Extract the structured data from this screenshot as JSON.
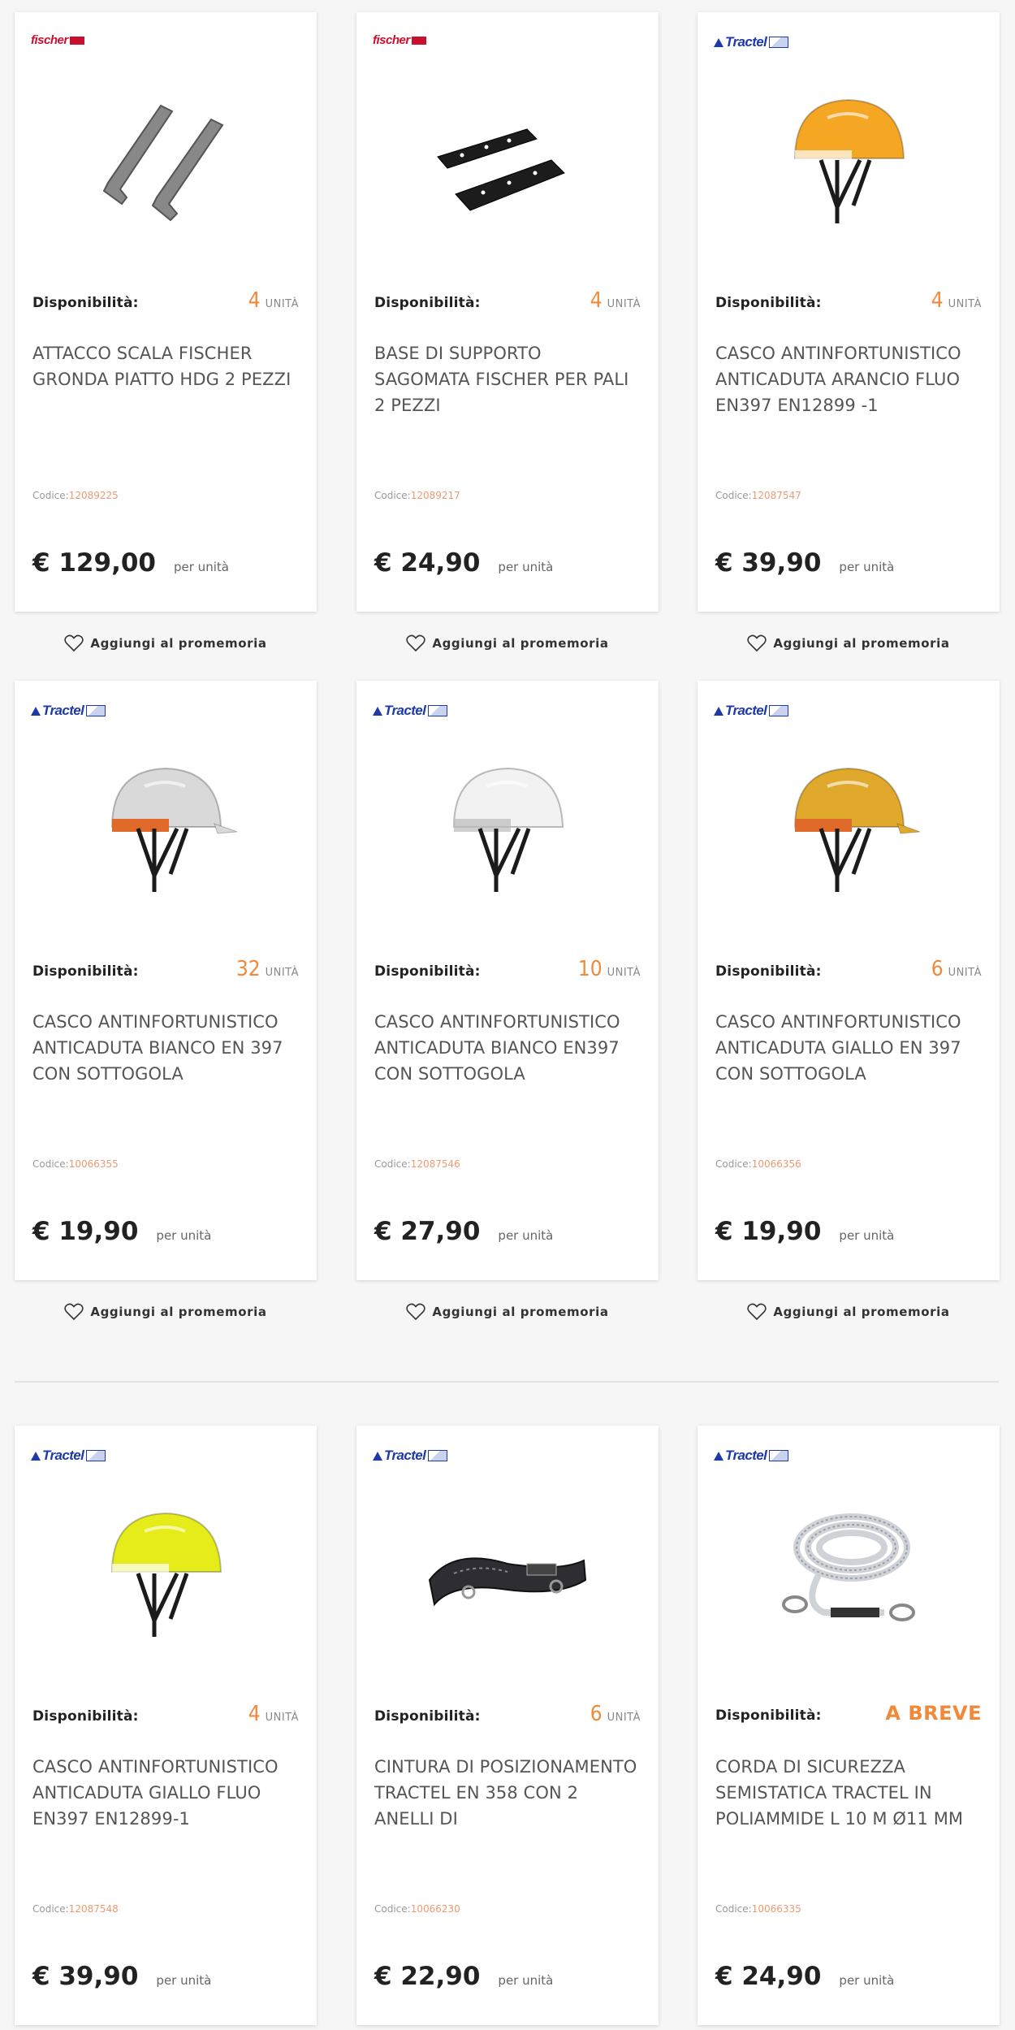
{
  "labels": {
    "availability": "Disponibilità:",
    "unit": "UNITÀ",
    "code": "Codice:",
    "per_unit": "per unità",
    "wishlist": "Aggiungi al promemoria"
  },
  "colors": {
    "accent": "#f08a3a",
    "code": "#ec9a73",
    "fischer": "#c8102e",
    "tractel": "#1e3aa8"
  },
  "products": [
    {
      "brand": "fischer",
      "brand_text": "fischer",
      "brand_sub": "",
      "image_icon": "ladder-bracket-icon",
      "availability": "4",
      "title": "ATTACCO SCALA FISCHER GRONDA PIATTO HDG 2 PEZZI",
      "code": "12089225",
      "price": "€ 129,00"
    },
    {
      "brand": "fischer",
      "brand_text": "fischer",
      "brand_sub": "",
      "image_icon": "support-plate-icon",
      "availability": "4",
      "title": "BASE DI SUPPORTO SAGOMATA FISCHER PER PALI 2 PEZZI",
      "code": "12089217",
      "price": "€ 24,90"
    },
    {
      "brand": "tractel",
      "brand_text": "Tractel",
      "image_icon": "orange-helmet-icon",
      "availability": "4",
      "title": "CASCO ANTINFORTUNISTICO ANTICADUTA ARANCIO FLUO EN397 EN12899 -1",
      "code": "12087547",
      "price": "€ 39,90"
    },
    {
      "brand": "tractel",
      "brand_text": "Tractel",
      "image_icon": "white-helmet-visor-icon",
      "availability": "32",
      "title": "CASCO ANTINFORTUNISTICO ANTICADUTA BIANCO EN 397 CON SOTTOGOLA",
      "code": "10066355",
      "price": "€ 19,90"
    },
    {
      "brand": "tractel",
      "brand_text": "Tractel",
      "image_icon": "white-helmet-icon",
      "availability": "10",
      "title": "CASCO ANTINFORTUNISTICO ANTICADUTA BIANCO EN397 CON SOTTOGOLA",
      "code": "12087546",
      "price": "€ 27,90"
    },
    {
      "brand": "tractel",
      "brand_text": "Tractel",
      "image_icon": "yellow-helmet-visor-icon",
      "availability": "6",
      "title": "CASCO ANTINFORTUNISTICO ANTICADUTA GIALLO EN 397 CON SOTTOGOLA",
      "code": "10066356",
      "price": "€ 19,90"
    },
    {
      "brand": "tractel",
      "brand_text": "Tractel",
      "image_icon": "yellow-fluo-helmet-icon",
      "availability": "4",
      "title": "CASCO ANTINFORTUNISTICO ANTICADUTA GIALLO FLUO EN397 EN12899-1",
      "code": "12087548",
      "price": "€ 39,90"
    },
    {
      "brand": "tractel",
      "brand_text": "Tractel",
      "image_icon": "harness-belt-icon",
      "availability": "6",
      "title": "CINTURA DI POSIZIONAMENTO TRACTEL EN 358 CON 2 ANELLI DI",
      "code": "10066230",
      "price": "€ 22,90"
    },
    {
      "brand": "tractel",
      "brand_text": "Tractel",
      "image_icon": "safety-rope-icon",
      "availability_text": "A BREVE",
      "title": "CORDA DI SICUREZZA SEMISTATICA TRACTEL IN POLIAMMIDE L 10 M Ø11 MM",
      "code": "10066335",
      "price": "€ 24,90"
    }
  ]
}
